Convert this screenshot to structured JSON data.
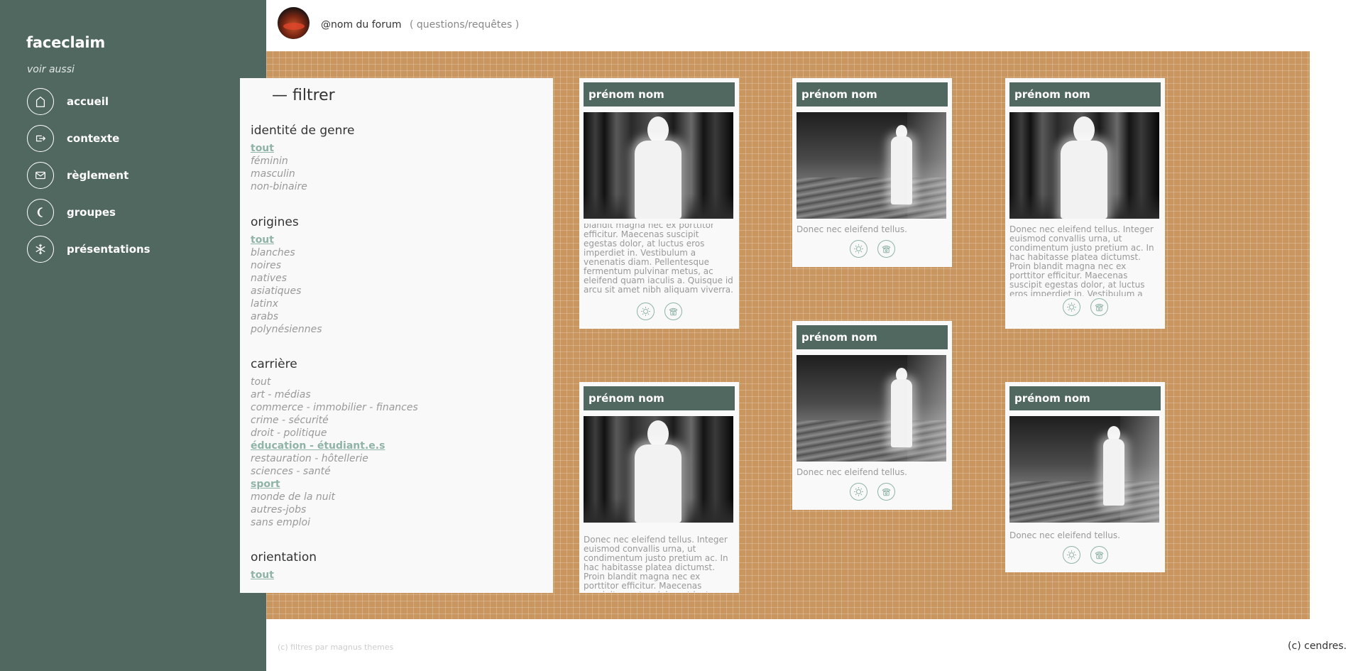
{
  "sidebar": {
    "title": "faceclaim",
    "subtitle": "voir aussi",
    "items": [
      {
        "label": "accueil",
        "icon": "house-icon"
      },
      {
        "label": "contexte",
        "icon": "door-arrow-icon"
      },
      {
        "label": "règlement",
        "icon": "envelope-icon"
      },
      {
        "label": "groupes",
        "icon": "moon-icon"
      },
      {
        "label": "présentations",
        "icon": "snowflake-icon"
      }
    ]
  },
  "header": {
    "forum_name": "@nom du forum",
    "link": "( questions/requêtes )"
  },
  "filter": {
    "title": "— filtrer",
    "groups": [
      {
        "heading": "identité de genre",
        "options": [
          {
            "label": "tout",
            "active": true
          },
          {
            "label": "féminin",
            "active": false
          },
          {
            "label": "masculin",
            "active": false
          },
          {
            "label": "non-binaire",
            "active": false
          }
        ]
      },
      {
        "heading": "origines",
        "options": [
          {
            "label": "tout",
            "active": true
          },
          {
            "label": "blanches",
            "active": false
          },
          {
            "label": "noires",
            "active": false
          },
          {
            "label": "natives",
            "active": false
          },
          {
            "label": "asiatiques",
            "active": false
          },
          {
            "label": "latinx",
            "active": false
          },
          {
            "label": "arabs",
            "active": false
          },
          {
            "label": "polynésiennes",
            "active": false
          }
        ]
      },
      {
        "heading": "carrière",
        "options": [
          {
            "label": "tout",
            "active": false
          },
          {
            "label": "art - médias",
            "active": false
          },
          {
            "label": "commerce - immobilier - finances",
            "active": false
          },
          {
            "label": "crime - sécurité",
            "active": false
          },
          {
            "label": "droit - politique",
            "active": false
          },
          {
            "label": "éducation - étudiant.e.s",
            "active": true
          },
          {
            "label": "restauration - hôtellerie",
            "active": false
          },
          {
            "label": "sciences - santé",
            "active": false
          },
          {
            "label": "sport",
            "active": true
          },
          {
            "label": "monde de la nuit",
            "active": false
          },
          {
            "label": "autres-jobs",
            "active": false
          },
          {
            "label": "sans emploi",
            "active": false
          }
        ]
      },
      {
        "heading": "orientation",
        "options": [
          {
            "label": "tout",
            "active": true
          }
        ]
      }
    ]
  },
  "cards": [
    {
      "name": "prénom nom",
      "image": "forest",
      "text": "blandit magna nec ex porttitor efficitur. Maecenas suscipit egestas dolor, at luctus eros imperdiet in. Vestibulum a venenatis diam. Pellentesque fermentum pulvinar metus, ac eleifend quam iaculis a. Quisque id arcu sit amet nibh aliquam viverra."
    },
    {
      "name": "prénom nom",
      "image": "bedroom",
      "text": "Donec nec eleifend tellus."
    },
    {
      "name": "prénom nom",
      "image": "forest",
      "text": "Donec nec eleifend tellus. Integer euismod convallis urna, ut condimentum justo pretium ac. In hac habitasse platea dictumst. Proin blandit magna nec ex porttitor efficitur. Maecenas suscipit egestas dolor, at luctus eros imperdiet in. Vestibulum a venenatis diam."
    },
    {
      "name": "prénom nom",
      "image": "bedroom",
      "text": "Donec nec eleifend tellus."
    },
    {
      "name": "prénom nom",
      "image": "forest",
      "text": "Donec nec eleifend tellus. Integer euismod convallis urna, ut condimentum justo pretium ac. In hac habitasse platea dictumst. Proin blandit magna nec ex porttitor efficitur. Maecenas suscipit egestas dolor, at luctus eros imperdiet in."
    },
    {
      "name": "prénom nom",
      "image": "bedroom",
      "text": "Donec nec eleifend tellus."
    }
  ],
  "card_icons": [
    "sun-icon",
    "telephone-icon"
  ],
  "footer": {
    "left": "(c) filtres par magnus themes",
    "right": "(c) cendres."
  }
}
